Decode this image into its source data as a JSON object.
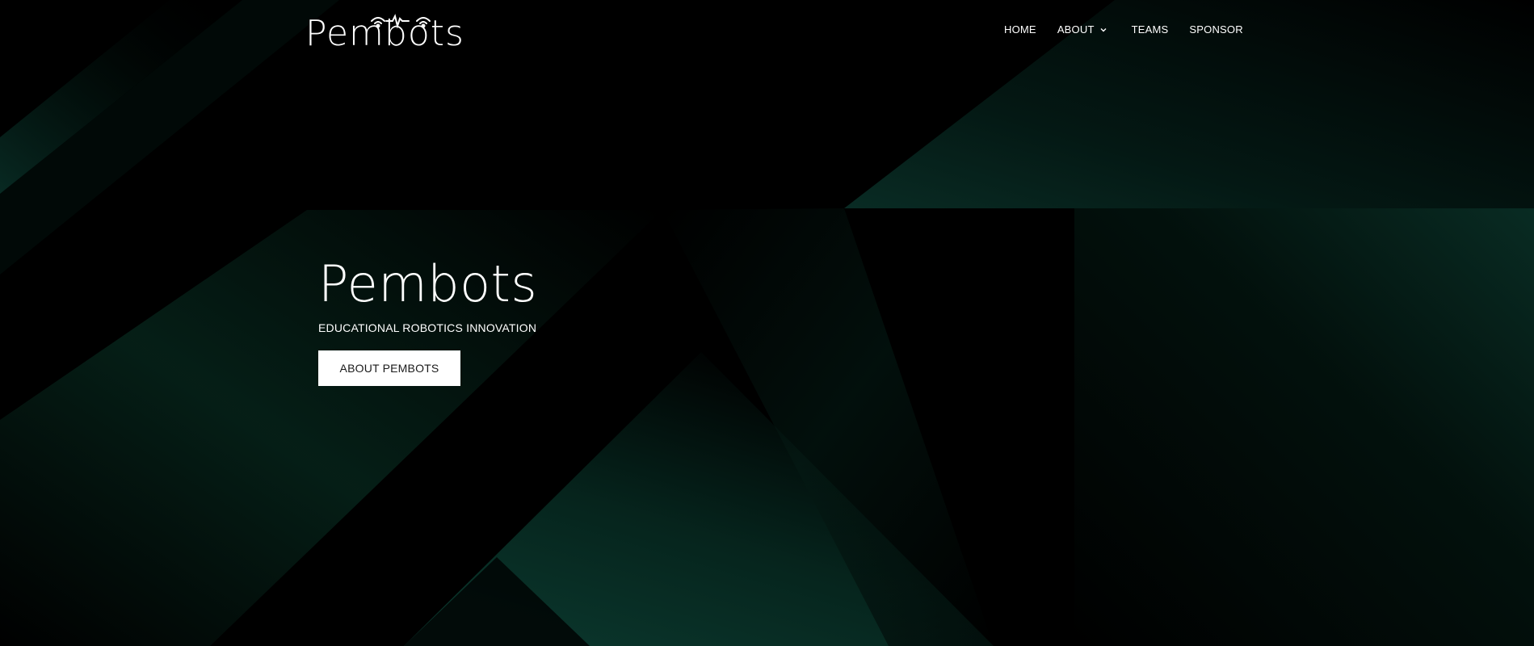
{
  "brand": {
    "logo_text": "Pembots",
    "logo_icon": "robot-antenna-logo-icon"
  },
  "nav": {
    "items": [
      {
        "label": "HOME"
      },
      {
        "label": "ABOUT",
        "has_dropdown": true
      },
      {
        "label": "TEAMS"
      },
      {
        "label": "SPONSOR"
      }
    ]
  },
  "hero": {
    "title": "Pembots",
    "subtitle": "EDUCATIONAL ROBOTICS INNOVATION",
    "button_label": "ABOUT PEMBOTS"
  },
  "colors": {
    "background": "#000000",
    "accent_green": "#0b3a30",
    "text": "#ffffff",
    "button_bg": "#ffffff",
    "button_text": "#1a1a1a"
  }
}
